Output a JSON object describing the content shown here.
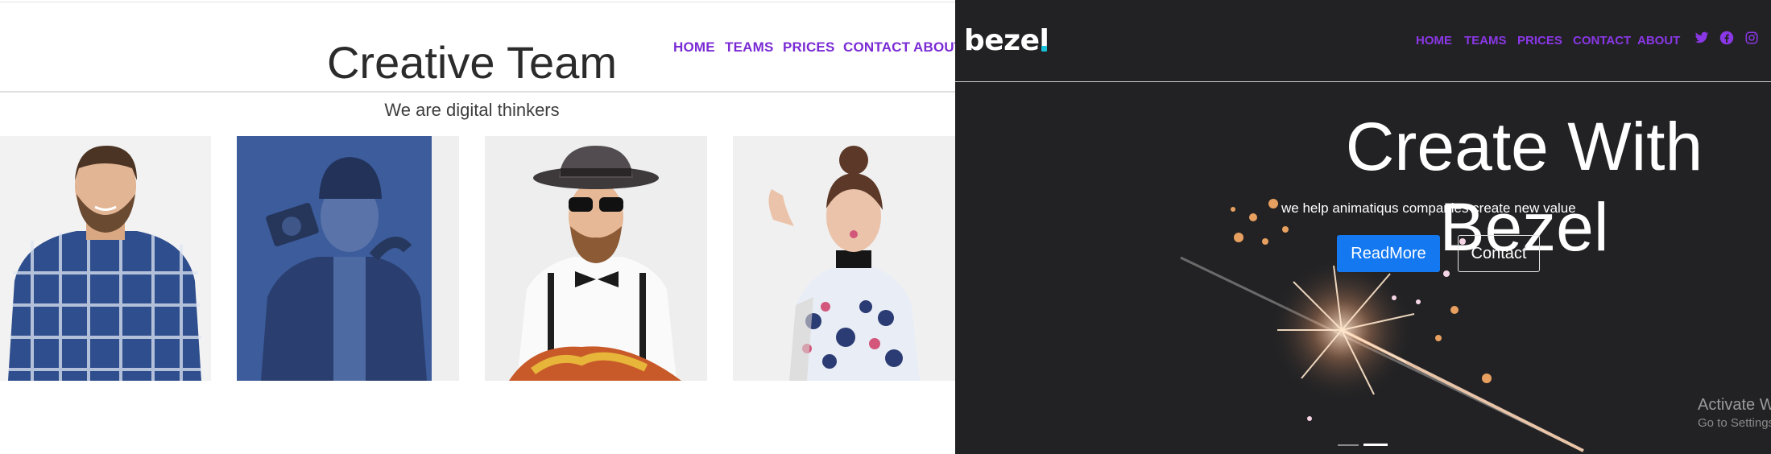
{
  "team_section": {
    "title": "Creative Team",
    "subtitle": "We are digital thinkers",
    "nav": [
      "HOME",
      "TEAMS",
      "PRICES",
      "CONTACT",
      "ABOUT"
    ],
    "members": [
      {
        "name": "member-bearded-plaid"
      },
      {
        "name": "member-beanie-camera"
      },
      {
        "name": "member-hat-sunglasses"
      },
      {
        "name": "member-floral-top"
      }
    ]
  },
  "hero": {
    "logo": "bezel",
    "nav": [
      "HOME",
      "TEAMS",
      "PRICES",
      "CONTACT",
      "ABOUT"
    ],
    "social_icons": [
      "twitter-icon",
      "facebook-icon",
      "instagram-icon"
    ],
    "title": "Create With Bezel",
    "subtitle": "we help animatiqus companies create new value",
    "readmore_label": "ReadMore",
    "contact_label": "Contact"
  },
  "windows_watermark": {
    "title": "Activate W",
    "subtitle": "Go to Settings"
  },
  "colors": {
    "nav_purple": "#7a2bd4",
    "hero_bg": "#222224",
    "primary_button": "#1479f0",
    "logo_dot": "#1bc1d8"
  }
}
